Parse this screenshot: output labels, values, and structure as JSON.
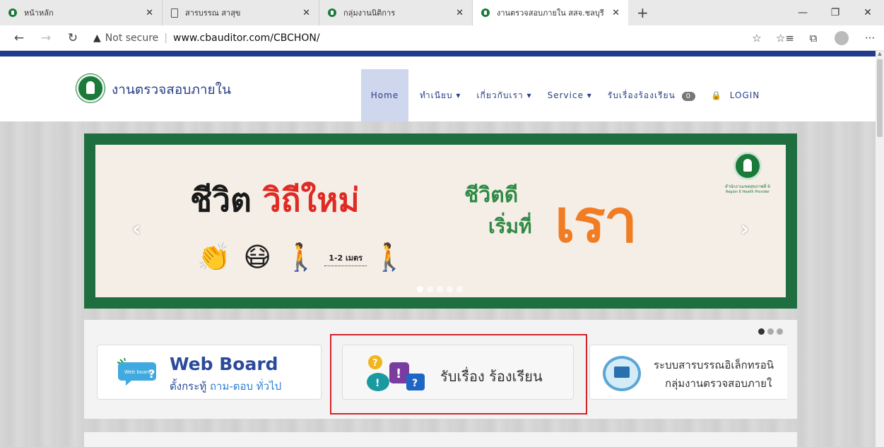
{
  "browser": {
    "tabs": [
      {
        "title": "หน้าหลัก",
        "icon": "moph-favicon-icon"
      },
      {
        "title": "สารบรรณ สาสุข",
        "icon": "document-icon"
      },
      {
        "title": "กลุ่มงานนิติการ",
        "icon": "moph-favicon-icon"
      },
      {
        "title": "งานตรวจสอบภายใน สสจ.ชลบุรี",
        "icon": "moph-favicon-icon",
        "active": true
      }
    ],
    "new_tab": "+",
    "window_controls": {
      "minimize": "—",
      "restore": "❐",
      "close": "✕"
    },
    "nav": {
      "back": "←",
      "forward": "→",
      "refresh": "↻"
    },
    "security": "Not secure",
    "url": "www.cbauditor.com/CBCHON/",
    "toolbar_icons": {
      "favorite": "☆",
      "favorites": "☆≡",
      "collections": "⧉",
      "more": "···"
    }
  },
  "site": {
    "title": "งานตรวจสอบภายใน",
    "menu": {
      "home": "Home",
      "registry": "ทำเนียบ ▾",
      "about": "เกี่ยวกับเรา ▾",
      "service": "Service ▾",
      "complaints": "รับเรื่องร้องเรียน",
      "complaints_count": "0",
      "login": "LOGIN"
    }
  },
  "slider": {
    "headline_a": "ชีวิต",
    "headline_b": "วิถีใหม่",
    "right_line1": "ชีวิตดี",
    "right_line2": "เริ่มที่",
    "right_big": "เรา",
    "distance": "1-2 เมตร",
    "brand_line1": "สำนักงานเขตสุขภาพที่ 6",
    "brand_line2": "Region 6 Health Provider",
    "prev": "‹",
    "next": "›",
    "dot_count": 5,
    "active_dot": 0
  },
  "cards": {
    "webboard_badge": "Web board",
    "webboard_title": "Web Board",
    "webboard_sub_a": "ตั้งกระทู้",
    "webboard_sub_b": "ถาม-ตอบ",
    "webboard_sub_c": "ทั่วไป",
    "complaint_title": "รับเรื่อง ร้องเรียน",
    "saraban_line1": "ระบบสารบรรณอิเล็กทรอนิ",
    "saraban_line2": "กลุ่มงานตรวจสอบภายใ"
  },
  "colors": {
    "brand_blue": "#2a3f86",
    "nav_bar": "#1f3c8f",
    "slider_frame": "#1f6e40",
    "highlight": "#d1242c",
    "accent_orange": "#f07d24"
  }
}
